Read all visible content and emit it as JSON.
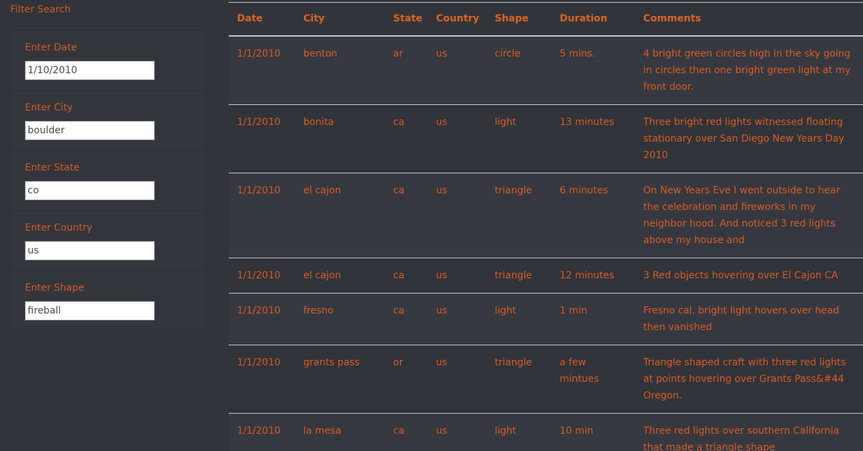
{
  "sidebar": {
    "title": "Filter Search",
    "filters": [
      {
        "label": "Enter Date",
        "value": "1/10/2010"
      },
      {
        "label": "Enter City",
        "value": "boulder"
      },
      {
        "label": "Enter State",
        "value": "co"
      },
      {
        "label": "Enter Country",
        "value": "us"
      },
      {
        "label": "Enter Shape",
        "value": "fireball"
      }
    ]
  },
  "table": {
    "headers": [
      "Date",
      "City",
      "State",
      "Country",
      "Shape",
      "Duration",
      "Comments"
    ],
    "rows": [
      [
        "1/1/2010",
        "benton",
        "ar",
        "us",
        "circle",
        "5 mins.",
        "4 bright green circles high in the sky going in circles then one bright green light at my front door."
      ],
      [
        "1/1/2010",
        "bonita",
        "ca",
        "us",
        "light",
        "13 minutes",
        "Three bright red lights witnessed floating stationary over San Diego New Years Day 2010"
      ],
      [
        "1/1/2010",
        "el cajon",
        "ca",
        "us",
        "triangle",
        "6 minutes",
        "On New Years Eve I went outside to hear the celebration and fireworks in my neighbor hood. And noticed 3 red lights above my house and"
      ],
      [
        "1/1/2010",
        "el cajon",
        "ca",
        "us",
        "triangle",
        "12 minutes",
        "3 Red objects hovering over El Cajon CA"
      ],
      [
        "1/1/2010",
        "fresno",
        "ca",
        "us",
        "light",
        "1 min",
        "Fresno cal. bright light hovers over head then vanished"
      ],
      [
        "1/1/2010",
        "grants pass",
        "or",
        "us",
        "triangle",
        "a few mintues",
        "Triangle shaped craft with three red lights at points hovering over Grants Pass&#44 Oregon."
      ],
      [
        "1/1/2010",
        "la mesa",
        "ca",
        "us",
        "light",
        "10 min",
        "Three red lights over southern California that made a triangle shape"
      ]
    ]
  }
}
